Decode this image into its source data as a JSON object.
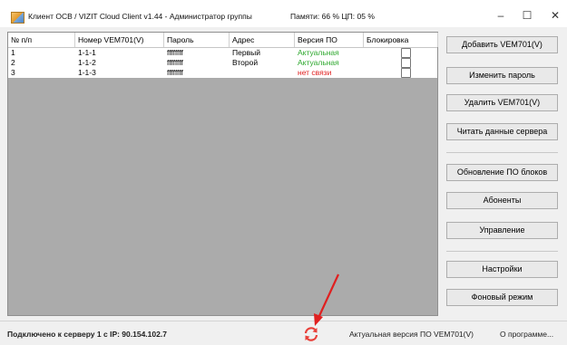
{
  "window": {
    "title": "Клиент ОСВ / VIZIT Cloud Client v1.44 - Администратор группы",
    "memory": "Памяти: 66 %  ЦП: 05 %",
    "controls": {
      "minimize": "–",
      "maximize": "☐",
      "close": "✕"
    }
  },
  "table": {
    "columns": [
      "№ п/п",
      "Номер VEM701(V)",
      "Пароль",
      "Адрес",
      "Версия ПО",
      "Блокировка"
    ],
    "rows": [
      {
        "num": "1",
        "number": "1-1-1",
        "password": "ffffffff",
        "address": "Первый",
        "version": "Актуальная",
        "version_status": "ok",
        "locked": false
      },
      {
        "num": "2",
        "number": "1-1-2",
        "password": "ffffffff",
        "address": "Второй",
        "version": "Актуальная",
        "version_status": "ok",
        "locked": false
      },
      {
        "num": "3",
        "number": "1-1-3",
        "password": "ffffffff",
        "address": "",
        "version": "нет связи",
        "version_status": "bad",
        "locked": false
      }
    ]
  },
  "buttons": {
    "add": "Добавить VEM701(V)",
    "change_password": "Изменить пароль",
    "delete": "Удалить VEM701(V)",
    "read_server": "Читать данные сервера",
    "update_firmware": "Обновление ПО блоков",
    "subscribers": "Абоненты",
    "control": "Управление",
    "settings": "Настройки",
    "background": "Фоновый режим"
  },
  "status": {
    "connection": "Подключено к серверу 1 с IP:  90.154.102.7",
    "current_version": "Актуальная версия ПО VEM701(V)",
    "about": "О программе..."
  },
  "icons": {
    "app": "app-icon",
    "refresh": "refresh-icon",
    "annotation": "red-arrow"
  },
  "colors": {
    "ok": "#2ea82e",
    "bad": "#e02020",
    "refresh": "#e8403a",
    "arrow": "#e02020"
  }
}
